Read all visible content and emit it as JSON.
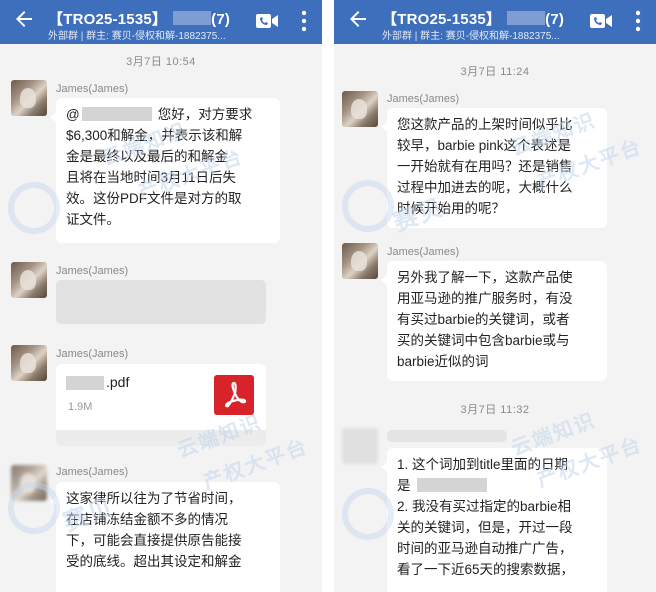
{
  "left": {
    "header": {
      "title_prefix": "【TRO25-1535】",
      "count": "(7)",
      "subtitle": "外部群 | 群主: 赛贝-侵权和解-1882375..."
    },
    "time1": "3月7日  10:54",
    "sender": "James(James)",
    "msg1": {
      "greeting_at": "@",
      "lines": [
        "您好，对方要求",
        "$6,300和解金，并表示该和解",
        "金是最终以及最后的和解金",
        "且将在当地时间3月11日后失",
        "效。这份PDF文件是对方的取",
        "证文件。"
      ]
    },
    "file": {
      "ext": ".pdf",
      "size": "1.9M"
    },
    "msg3": {
      "lines": [
        "这家律所以往为了节省时间，",
        "在店铺冻结金额不多的情况",
        "下，可能会直接提供原告能接",
        "受的底线。超出其设定和解金"
      ]
    }
  },
  "right": {
    "header": {
      "title_prefix": "【TRO25-1535】",
      "count": "(7)",
      "subtitle": "外部群 | 群主: 赛贝-侵权和解-1882375..."
    },
    "time1": "3月7日  11:24",
    "sender": "James(James)",
    "msg1": {
      "lines": [
        "您这款产品的上架时间似乎比",
        "较早，barbie pink这个表述是",
        "一开始就有在用吗？还是销售",
        "过程中加进去的呢，大概什么",
        "时候开始用的呢？"
      ]
    },
    "msg2": {
      "lines": [
        "另外我了解一下，这款产品使",
        "用亚马逊的推广服务时，有没",
        "有买过barbie的关键词，或者",
        "买的关键词中包含barbie或与",
        "barbie近似的词"
      ]
    },
    "time2": "3月7日  11:32",
    "msg3": {
      "lines": [
        "1. 这个词加到title里面的日期",
        "是",
        "2. 我没有买过指定的barbie相",
        "关的关键词，但是，开过一段",
        "时间的亚马逊自动推广广告，",
        "看了一下近65天的搜索数据，"
      ]
    }
  },
  "watermark": {
    "brand": "赛贝",
    "line1": "云端知识",
    "line2": "产权大平台"
  },
  "colors": {
    "header_bg": "#3d6fbd",
    "chat_bg": "#f3f3f3",
    "bubble": "#ffffff",
    "pdf_red": "#d8232a",
    "watermark": "#c4d6ed"
  },
  "icons": {
    "back": "arrow-left-icon",
    "call": "video-call-icon",
    "more": "more-vertical-icon",
    "file": "pdf-icon"
  }
}
